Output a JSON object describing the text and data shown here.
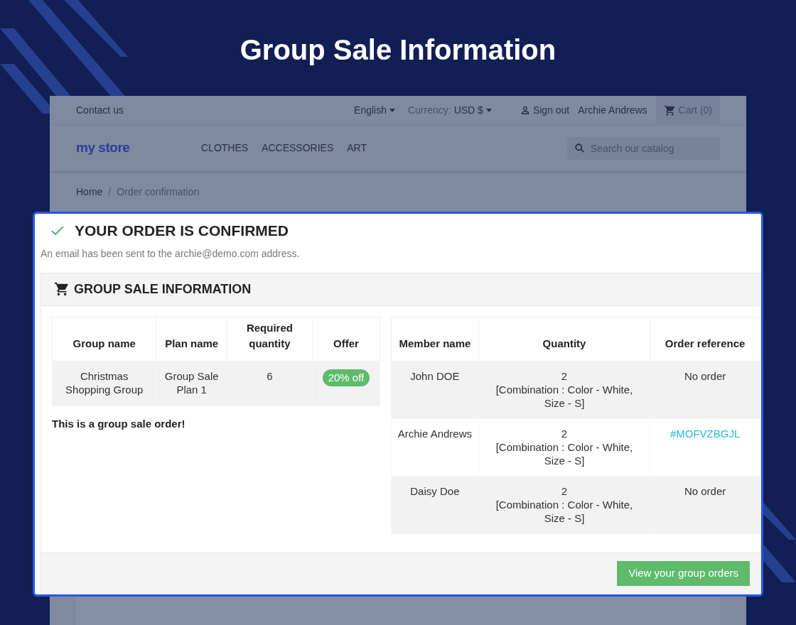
{
  "banner_title": "Group Sale Information",
  "store": {
    "top_bar": {
      "contact": "Contact us",
      "language": "English",
      "currency_label": "Currency:",
      "currency": "USD $",
      "sign_out": "Sign out",
      "user": "Archie Andrews",
      "cart": "Cart (0)"
    },
    "logo": "my store",
    "menu": [
      "CLOTHES",
      "ACCESSORIES",
      "ART"
    ],
    "search": {
      "placeholder": "Search our catalog"
    },
    "breadcrumb_separator": "/",
    "breadcrumb": [
      {
        "label": "Home",
        "current": false
      },
      {
        "label": "Order confirmation",
        "current": true
      }
    ]
  },
  "confirmation": {
    "title": "YOUR ORDER IS CONFIRMED",
    "message": "An email has been sent to the archie@demo.com address.",
    "section_title": "GROUP SALE INFORMATION",
    "group_table": {
      "columns": [
        "Group name",
        "Plan name",
        "Required quantity",
        "Offer"
      ],
      "rows": [
        {
          "group_name": "Christmas Shopping Group",
          "plan_name": "Group Sale Plan 1",
          "required_quantity": "6",
          "offer": "20% off"
        }
      ]
    },
    "note": "This is a group sale order!",
    "members_table": {
      "columns": [
        "Member name",
        "Quantity",
        "Order reference"
      ],
      "rows": [
        {
          "member": "John DOE",
          "quantity": "2",
          "combination": "[Combination : Color - White, Size - S]",
          "order_reference": {
            "text": "No order",
            "kind": "text"
          }
        },
        {
          "member": "Archie Andrews",
          "quantity": "2",
          "combination": "[Combination : Color - White, Size - S]",
          "order_reference": {
            "text": "#MOFVZBGJL",
            "kind": "link"
          }
        },
        {
          "member": "Daisy Doe",
          "quantity": "2",
          "combination": "[Combination : Color - White, Size - S]",
          "order_reference": {
            "text": "No order",
            "kind": "text"
          }
        }
      ]
    },
    "button": "View your group orders"
  }
}
